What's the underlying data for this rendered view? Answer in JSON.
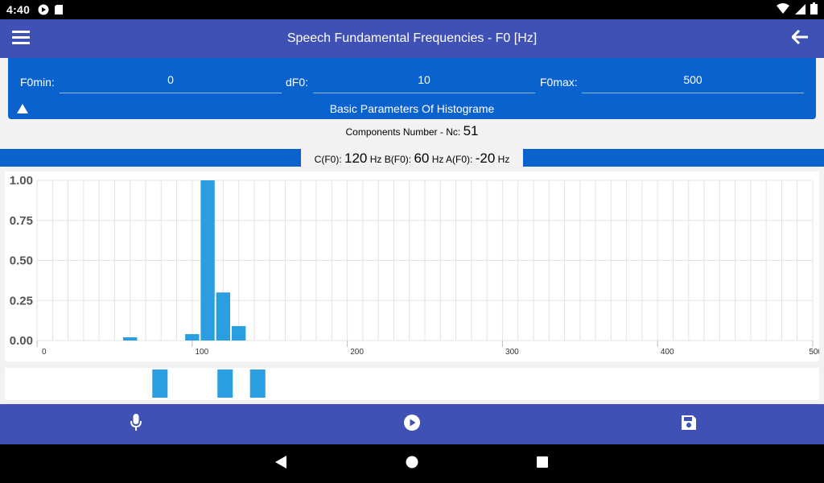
{
  "status_bar": {
    "time": "4:40",
    "icons": [
      "media-icon",
      "sd-card-icon",
      "wifi-icon",
      "signal-icon",
      "battery-icon"
    ]
  },
  "app_bar": {
    "title": "Speech Fundamental Frequencies - F0 [Hz]",
    "menu_icon": "hamburger-menu-icon",
    "back_icon": "arrow-back-icon"
  },
  "params": {
    "f0min_label": "F0min:",
    "f0min_value": "0",
    "df0_label": "dF0:",
    "df0_value": "10",
    "f0max_label": "F0max:",
    "f0max_value": "500",
    "caption": "Basic Parameters Of Histograme",
    "toggle_icon": "triangle-up-icon"
  },
  "components": {
    "label": "Components Number - Nc:",
    "value": "51"
  },
  "result": {
    "c_label": "C(F0):",
    "c_value": "120",
    "c_unit": "Hz",
    "b_label": "B(F0):",
    "b_value": "60",
    "b_unit": "Hz",
    "a_label": "A(F0):",
    "a_value": "-20",
    "a_unit": "Hz"
  },
  "chart_data": {
    "type": "bar",
    "x_ticks": [
      "0",
      "100",
      "200",
      "300",
      "400",
      "500"
    ],
    "y_ticks": [
      "0.00",
      "0.25",
      "0.50",
      "0.75",
      "1.00"
    ],
    "xlim": [
      0,
      500
    ],
    "ylim": [
      0,
      1
    ],
    "grid": true,
    "bar_color": "#2a9ee0",
    "bars": [
      {
        "x": 60,
        "y": 0.02
      },
      {
        "x": 100,
        "y": 0.04
      },
      {
        "x": 110,
        "y": 1.0
      },
      {
        "x": 120,
        "y": 0.3
      },
      {
        "x": 130,
        "y": 0.09
      }
    ]
  },
  "strip": {
    "color": "#2a9ee0",
    "blocks": [
      {
        "x": 95
      },
      {
        "x": 135
      },
      {
        "x": 155
      }
    ]
  },
  "bottom_bar": {
    "icons": [
      "microphone-icon",
      "play-icon",
      "save-icon"
    ]
  },
  "colors": {
    "primary": "#3f51b5",
    "panel_blue": "#0a62cf",
    "bar": "#2a9ee0"
  }
}
